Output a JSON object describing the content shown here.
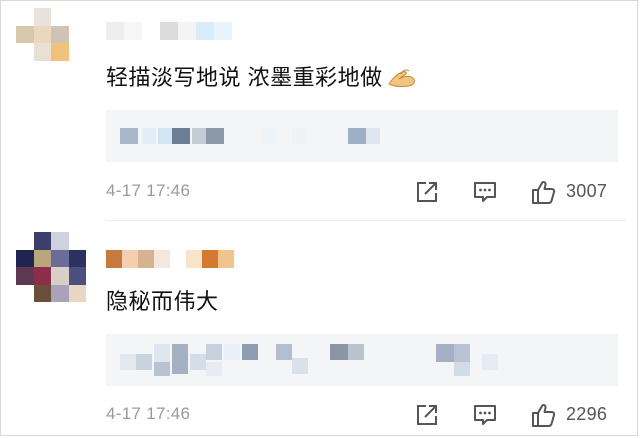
{
  "comments": [
    {
      "text": "轻描淡写地说 浓墨重彩地做",
      "emoji": "pinch-hand-emoji",
      "time": "4-17 17:46",
      "likes": "3007"
    },
    {
      "text": "隐秘而伟大",
      "time": "4-17 17:46",
      "likes": "2296"
    }
  ],
  "colors": {
    "text": "#111111",
    "meta": "#9a9a9a",
    "reply_bg": "#f4f5f7",
    "icon": "#555555"
  },
  "icons": [
    "share-icon",
    "comment-icon",
    "like-icon"
  ]
}
